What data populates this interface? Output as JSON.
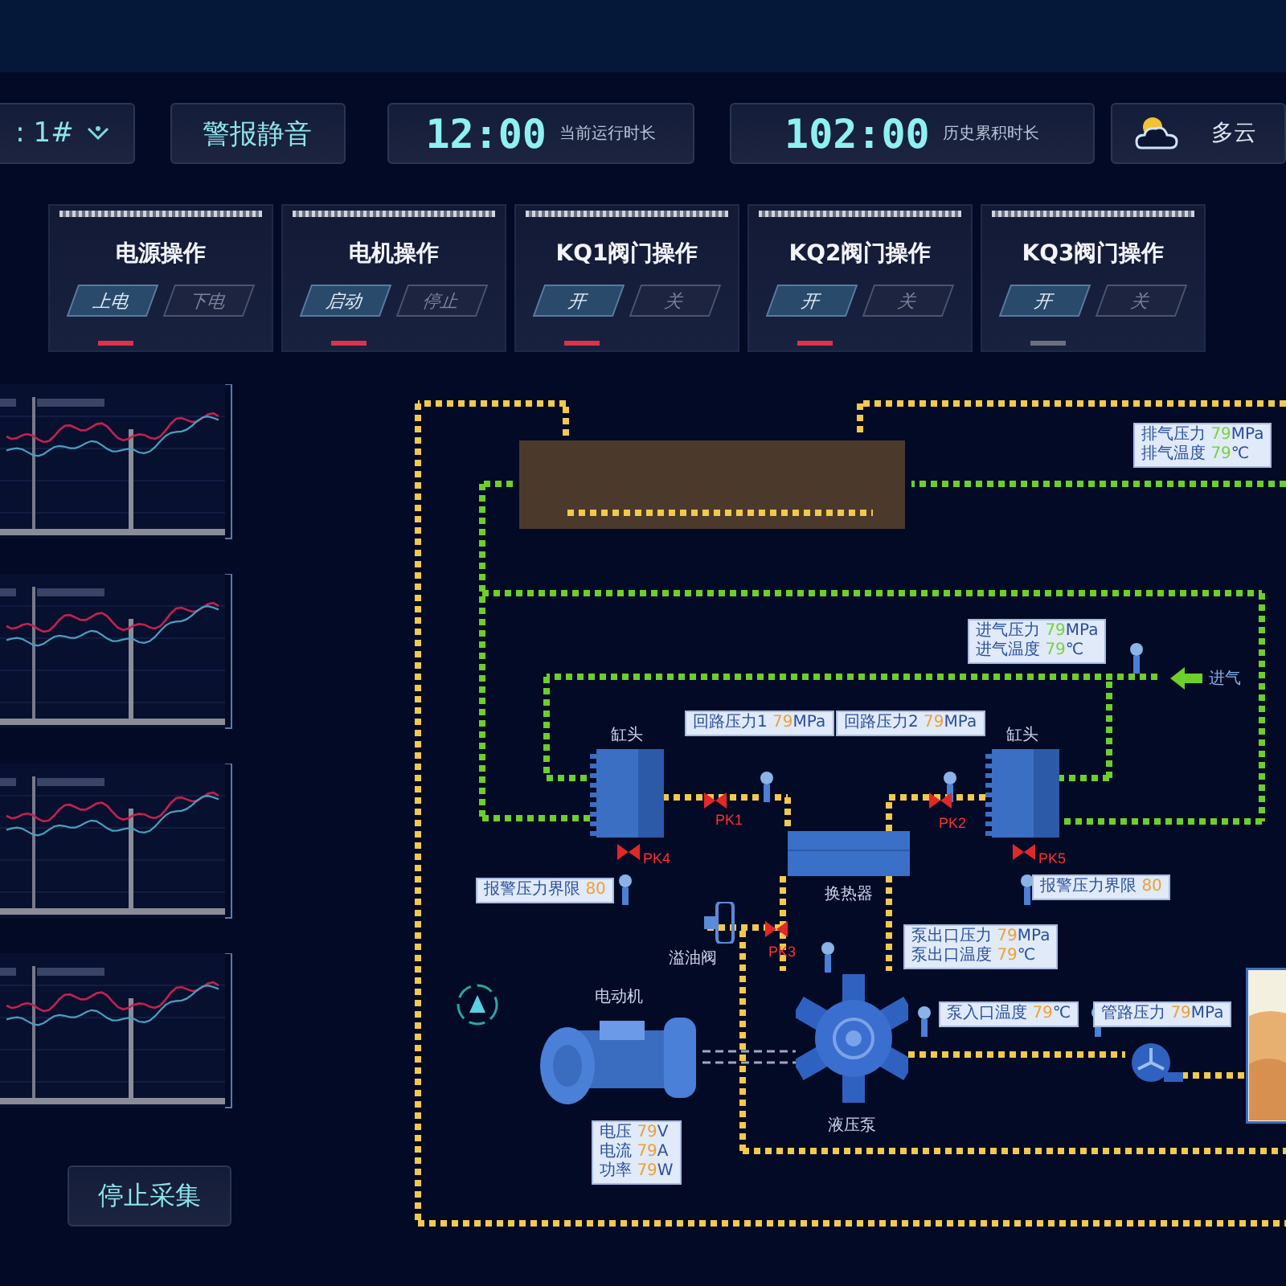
{
  "toolbar": {
    "dropdown": {
      "value": ": 1#"
    },
    "mute_button": "警报静音",
    "timers": [
      {
        "time": "12:00",
        "label": "当前运行时长"
      },
      {
        "time": "102:00",
        "label": "历史累积时长"
      }
    ],
    "weather": {
      "label": "多云"
    }
  },
  "cards": [
    {
      "title": "电源操作",
      "active": true,
      "options": [
        {
          "label": "上电",
          "selected": true
        },
        {
          "label": "下电",
          "selected": false
        }
      ]
    },
    {
      "title": "电机操作",
      "active": true,
      "options": [
        {
          "label": "启动",
          "selected": true
        },
        {
          "label": "停止",
          "selected": false
        }
      ]
    },
    {
      "title": "KQ1阀门操作",
      "active": true,
      "options": [
        {
          "label": "开",
          "selected": true
        },
        {
          "label": "关",
          "selected": false
        }
      ]
    },
    {
      "title": "KQ2阀门操作",
      "active": true,
      "options": [
        {
          "label": "开",
          "selected": true
        },
        {
          "label": "关",
          "selected": false
        }
      ]
    },
    {
      "title": "KQ3阀门操作",
      "active": false,
      "options": [
        {
          "label": "开",
          "selected": true
        },
        {
          "label": "关",
          "selected": false
        }
      ]
    }
  ],
  "charts": [
    {
      "kind": "line-chart"
    },
    {
      "kind": "line-chart"
    },
    {
      "kind": "line-chart"
    },
    {
      "kind": "line-chart"
    }
  ],
  "stop_button": "停止采集",
  "diagram": {
    "components": [
      {
        "kind": "tank"
      },
      {
        "kind": "head",
        "label": "缸头"
      },
      {
        "kind": "head",
        "label": "缸头"
      },
      {
        "kind": "exchanger",
        "label": "换热器"
      },
      {
        "kind": "relief",
        "label": "溢油阀"
      },
      {
        "kind": "motor",
        "label": "电动机"
      },
      {
        "kind": "pump",
        "label": "液压泵"
      },
      {
        "kind": "fan"
      },
      {
        "kind": "reservoir"
      },
      {
        "kind": "inlet",
        "label": "进气"
      }
    ],
    "valves": [
      {
        "label": "PK1"
      },
      {
        "label": "PK2"
      },
      {
        "label": "PK3"
      },
      {
        "label": "PK4"
      },
      {
        "label": "PK5"
      }
    ],
    "readouts": [
      {
        "kind": "gas",
        "lines": [
          {
            "label": "排气压力",
            "value": "79",
            "unit": "MPa"
          },
          {
            "label": "排气温度",
            "value": "79",
            "unit": "℃"
          }
        ]
      },
      {
        "kind": "gas",
        "lines": [
          {
            "label": "进气压力",
            "value": "79",
            "unit": "MPa"
          },
          {
            "label": "进气温度",
            "value": "79",
            "unit": "℃"
          }
        ]
      },
      {
        "kind": "oil",
        "lines": [
          {
            "label": "回路压力1",
            "value": "79",
            "unit": "MPa"
          }
        ]
      },
      {
        "kind": "oil",
        "lines": [
          {
            "label": "回路压力2",
            "value": "79",
            "unit": "MPa"
          }
        ]
      },
      {
        "kind": "oil",
        "lines": [
          {
            "label": "报警压力界限",
            "value": "80"
          }
        ]
      },
      {
        "kind": "oil",
        "lines": [
          {
            "label": "报警压力界限",
            "value": "80"
          }
        ]
      },
      {
        "kind": "oil",
        "lines": [
          {
            "label": "泵出口压力",
            "value": "79",
            "unit": "MPa"
          },
          {
            "label": "泵出口温度",
            "value": "79",
            "unit": "℃"
          }
        ]
      },
      {
        "kind": "oil",
        "lines": [
          {
            "label": "泵入口温度",
            "value": "79",
            "unit": "℃"
          }
        ]
      },
      {
        "kind": "oil",
        "lines": [
          {
            "label": "管路压力",
            "value": "79",
            "unit": "MPa"
          }
        ]
      },
      {
        "kind": "oil",
        "lines": [
          {
            "label": "电压",
            "value": "79",
            "unit": "V"
          },
          {
            "label": "电流",
            "value": "79",
            "unit": "A"
          },
          {
            "label": "功率",
            "value": "79",
            "unit": "W"
          }
        ]
      }
    ]
  }
}
